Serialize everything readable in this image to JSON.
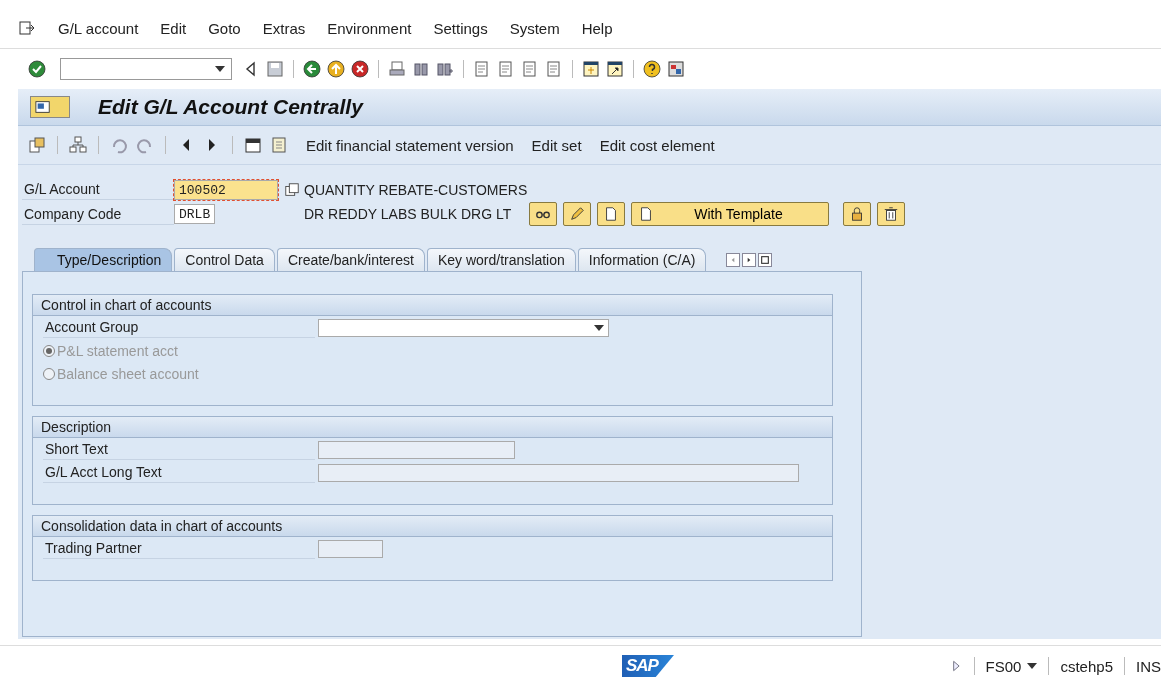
{
  "menu": {
    "items": [
      "G/L account",
      "Edit",
      "Goto",
      "Extras",
      "Environment",
      "Settings",
      "System",
      "Help"
    ]
  },
  "title": "Edit G/L Account Centrally",
  "app_toolbar": {
    "actions": [
      "Edit financial statement version",
      "Edit set",
      "Edit cost element"
    ]
  },
  "header": {
    "gl_account": {
      "label": "G/L Account",
      "value": "100502",
      "description": "QUANTITY REBATE-CUSTOMERS"
    },
    "company_code": {
      "label": "Company Code",
      "value": "DRLB",
      "description": "DR REDDY LABS BULK DRG LT"
    },
    "template_button": "With Template"
  },
  "tabs": [
    {
      "label": "Type/Description",
      "selected": true
    },
    {
      "label": "Control Data",
      "selected": false
    },
    {
      "label": "Create/bank/interest",
      "selected": false
    },
    {
      "label": "Key word/translation",
      "selected": false
    },
    {
      "label": "Information (C/A)",
      "selected": false
    }
  ],
  "sections": [
    {
      "title": "Control in chart of accounts",
      "rows": [
        {
          "kind": "dropdown",
          "label": "Account Group"
        },
        {
          "kind": "radio",
          "label": "P&L statement acct",
          "selected": true,
          "disabled": true
        },
        {
          "kind": "radio",
          "label": "Balance sheet account",
          "selected": false,
          "disabled": true
        }
      ]
    },
    {
      "title": "Description",
      "rows": [
        {
          "kind": "text",
          "label": "Short Text"
        },
        {
          "kind": "long_text",
          "label": "G/L Acct Long Text"
        }
      ]
    },
    {
      "title": "Consolidation data in chart of accounts",
      "rows": [
        {
          "kind": "code",
          "label": "Trading Partner"
        }
      ]
    }
  ],
  "status_bar": {
    "logo": "SAP",
    "transaction": "FS00",
    "system": "cstehp5",
    "mode": "INS"
  }
}
